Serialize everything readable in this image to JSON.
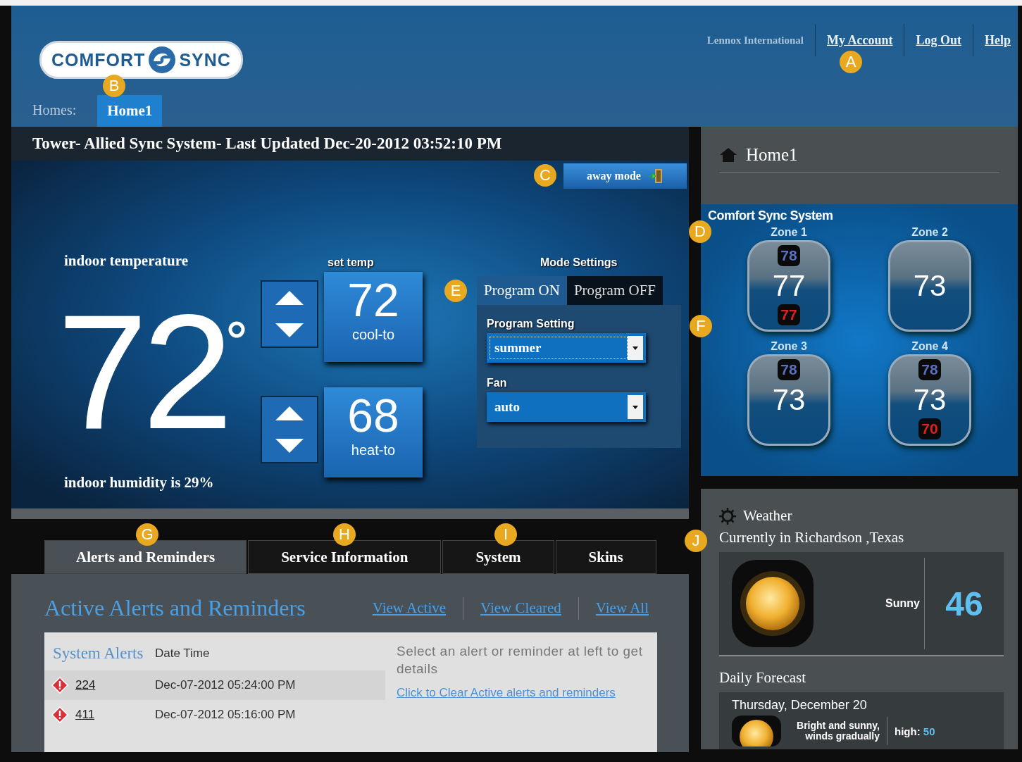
{
  "header": {
    "logo": {
      "left": "COMFORT",
      "right": "SYNC"
    },
    "links": [
      {
        "label": "Lennox International",
        "kind": "plain"
      },
      {
        "label": "My Account",
        "kind": "link"
      },
      {
        "label": "Log Out",
        "kind": "link"
      },
      {
        "label": "Help",
        "kind": "link"
      }
    ],
    "homes_label": "Homes:",
    "homes": [
      {
        "label": "Home1",
        "selected": true
      }
    ]
  },
  "status": "Tower- Allied Sync System- Last Updated Dec-20-2012 03:52:10 PM",
  "away_button": "away mode",
  "indoor": {
    "label": "indoor temperature",
    "temperature": "72",
    "humidity": "indoor humidity is 29%"
  },
  "set_temp": {
    "label": "set temp",
    "setpoints": [
      {
        "value": "72",
        "label": "cool-to"
      },
      {
        "value": "68",
        "label": "heat-to"
      }
    ]
  },
  "mode": {
    "label": "Mode Settings",
    "tabs": [
      {
        "label": "Program ON",
        "selected": true
      },
      {
        "label": "Program OFF",
        "selected": false
      }
    ],
    "fields": [
      {
        "label": "Program Setting",
        "value": "summer",
        "focused": true
      },
      {
        "label": "Fan",
        "value": "auto",
        "focused": false
      }
    ]
  },
  "sidebar": {
    "home": "Home1",
    "system_title": "Comfort Sync System",
    "zones": [
      {
        "name": "Zone 1",
        "cool": "78",
        "current": "77",
        "heat": "77"
      },
      {
        "name": "Zone 2",
        "current": "73"
      },
      {
        "name": "Zone 3",
        "cool": "78",
        "current": "73"
      },
      {
        "name": "Zone 4",
        "cool": "78",
        "current": "73",
        "heat": "70"
      }
    ]
  },
  "weather": {
    "title": "Weather",
    "location": "Currently in Richardson ,Texas",
    "condition": "Sunny",
    "temperature": "46",
    "forecast_title": "Daily Forecast",
    "forecast": {
      "date": "Thursday, December 20",
      "description": "Bright and sunny, winds gradually",
      "high_label": "high:",
      "high": "50"
    }
  },
  "tabs": [
    {
      "label": "Alerts and Reminders",
      "selected": true
    },
    {
      "label": "Service Information",
      "selected": false
    },
    {
      "label": "System",
      "selected": false
    },
    {
      "label": "Skins",
      "selected": false
    }
  ],
  "alerts": {
    "title": "Active Alerts and Reminders",
    "filters": [
      "View Active",
      "View Cleared",
      "View All"
    ],
    "columns": [
      "System Alerts",
      "Date Time"
    ],
    "rows": [
      {
        "code": "224",
        "datetime": "Dec-07-2012 05:24:00 PM",
        "selected": true
      },
      {
        "code": "411",
        "datetime": "Dec-07-2012 05:16:00 PM",
        "selected": false
      }
    ],
    "message": "Select an alert or reminder at left to get details",
    "clear_link": "Click to Clear Active alerts and reminders"
  },
  "callouts": [
    "A",
    "B",
    "C",
    "D",
    "E",
    "F",
    "G",
    "H",
    "I",
    "J"
  ]
}
